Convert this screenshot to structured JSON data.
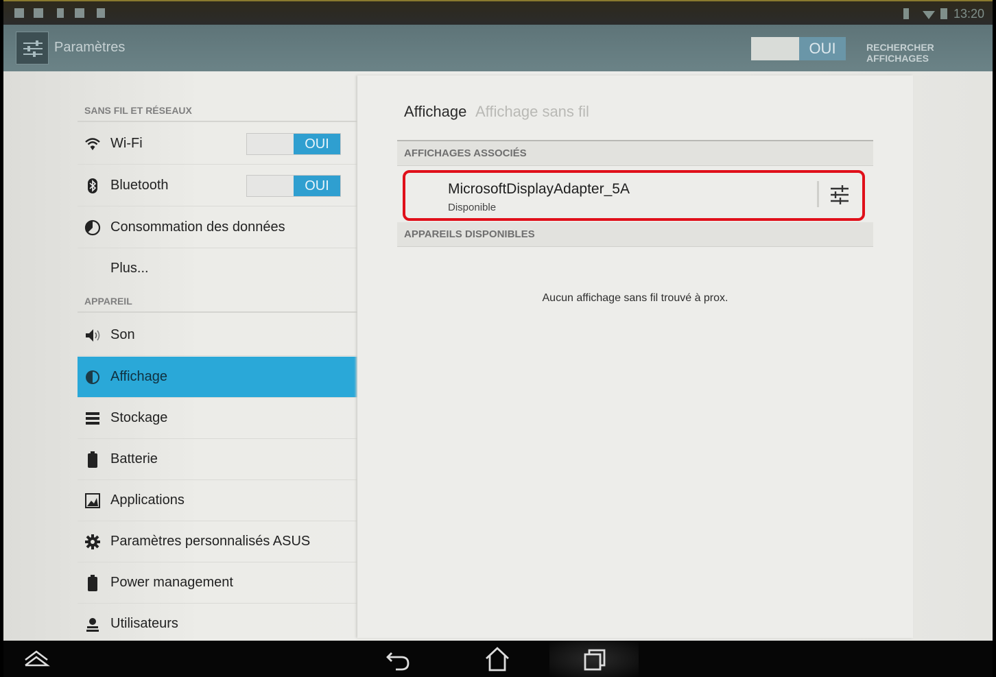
{
  "status_bar": {
    "time": "13:20"
  },
  "action_bar": {
    "title": "Paramètres",
    "toggle_label": "OUI",
    "search_label": "RECHERCHER AFFICHAGES"
  },
  "left_pane": {
    "sections": [
      {
        "header": "SANS FIL ET RÉSEAUX"
      },
      {
        "header": "APPAREIL"
      }
    ],
    "items": [
      {
        "label": "Wi-Fi",
        "icon": "wifi-icon",
        "toggle": "OUI"
      },
      {
        "label": "Bluetooth",
        "icon": "bluetooth-icon",
        "toggle": "OUI"
      },
      {
        "label": "Consommation des données",
        "icon": "data-usage-icon"
      },
      {
        "label": "Plus..."
      },
      {
        "label": "Son",
        "icon": "volume-icon"
      },
      {
        "label": "Affichage",
        "icon": "brightness-icon",
        "active": true
      },
      {
        "label": "Stockage",
        "icon": "storage-icon"
      },
      {
        "label": "Batterie",
        "icon": "battery-icon"
      },
      {
        "label": "Applications",
        "icon": "apps-icon"
      },
      {
        "label": "Paramètres personnalisés ASUS",
        "icon": "gear-icon"
      },
      {
        "label": "Power management",
        "icon": "battery-icon"
      },
      {
        "label": "Utilisateurs",
        "icon": "user-icon"
      }
    ]
  },
  "right_pane": {
    "breadcrumb_main": "Affichage",
    "breadcrumb_sub": "Affichage sans fil",
    "paired_header": "AFFICHAGES ASSOCIÉS",
    "device": {
      "name": "MicrosoftDisplayAdapter_5A",
      "status": "Disponible"
    },
    "available_header": "APPAREILS DISPONIBLES",
    "empty_message": "Aucun affichage sans fil trouvé à prox."
  },
  "colors": {
    "accent": "#2aa8d8",
    "highlight_box": "#e0101a",
    "actionbar": "#647a7e"
  }
}
